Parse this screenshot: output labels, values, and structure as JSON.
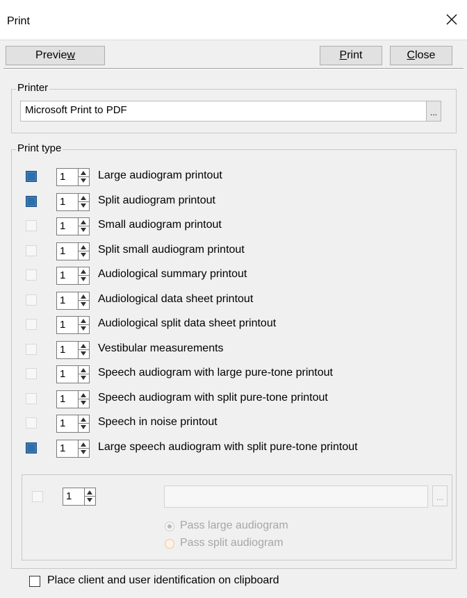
{
  "window": {
    "title": "Print"
  },
  "toolbar": {
    "preview": "Preview",
    "print": "Print",
    "close": "Close"
  },
  "printer": {
    "legend": "Printer",
    "name": "Microsoft Print to PDF",
    "browse": "..."
  },
  "print_type": {
    "legend": "Print type",
    "items": [
      {
        "checked": true,
        "count": "1",
        "label": "Large audiogram printout"
      },
      {
        "checked": true,
        "count": "1",
        "label": "Split audiogram printout"
      },
      {
        "checked": false,
        "count": "1",
        "label": "Small audiogram printout"
      },
      {
        "checked": false,
        "count": "1",
        "label": "Split small audiogram printout"
      },
      {
        "checked": false,
        "count": "1",
        "label": "Audiological summary printout"
      },
      {
        "checked": false,
        "count": "1",
        "label": "Audiological data sheet printout"
      },
      {
        "checked": false,
        "count": "1",
        "label": "Audiological split data sheet printout"
      },
      {
        "checked": false,
        "count": "1",
        "label": "Vestibular measurements"
      },
      {
        "checked": false,
        "count": "1",
        "label": "Speech audiogram with large pure-tone printout"
      },
      {
        "checked": false,
        "count": "1",
        "label": "Speech audiogram with split pure-tone printout"
      },
      {
        "checked": false,
        "count": "1",
        "label": "Speech in noise printout"
      },
      {
        "checked": true,
        "count": "1",
        "label": "Large speech audiogram with split pure-tone printout"
      }
    ],
    "custom": {
      "count": "1",
      "browse": "...",
      "pass_large": "Pass large audiogram",
      "pass_split": "Pass split audiogram"
    }
  },
  "footer": {
    "clipboard_label": "Place client and user identification on clipboard"
  }
}
